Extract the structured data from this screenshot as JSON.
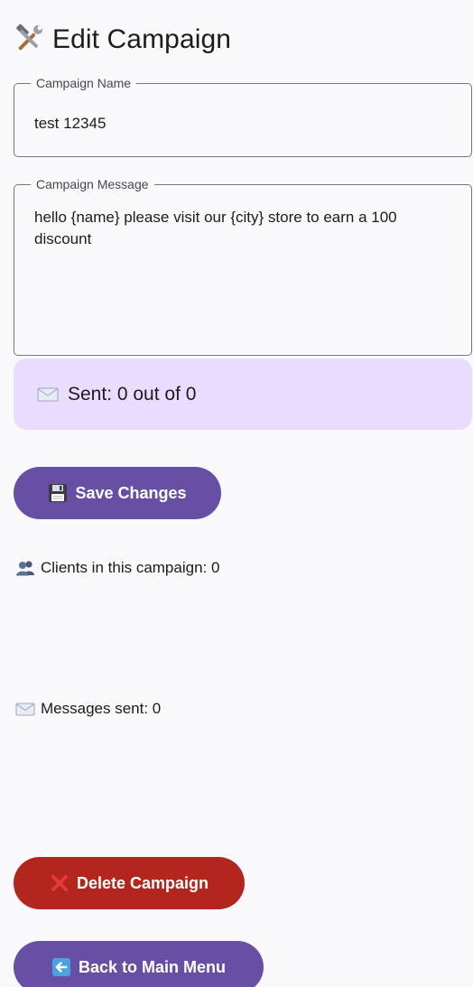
{
  "header": {
    "title": "Edit Campaign",
    "icon": "tools-icon"
  },
  "fields": {
    "name": {
      "label": "Campaign Name",
      "value": "test 12345"
    },
    "message": {
      "label": "Campaign Message",
      "value": "hello {name} please visit our {city} store to earn a 100 discount"
    }
  },
  "status": {
    "icon": "envelope-icon",
    "text": "Sent: 0 out of 0"
  },
  "buttons": {
    "save": {
      "label": "Save Changes",
      "icon": "floppy-disk-icon"
    },
    "delete": {
      "label": "Delete Campaign",
      "icon": "cross-mark-icon"
    },
    "back": {
      "label": "Back to Main Menu",
      "icon": "left-arrow-icon"
    }
  },
  "info": {
    "clients": {
      "icon": "people-icon",
      "text": "Clients in this campaign: 0"
    },
    "messages_sent": {
      "icon": "envelope-icon",
      "text": "Messages sent: 0"
    }
  },
  "colors": {
    "primary": "#6750a4",
    "danger": "#b3261e",
    "status_card": "#eadcff",
    "background": "#f9f9fb"
  }
}
